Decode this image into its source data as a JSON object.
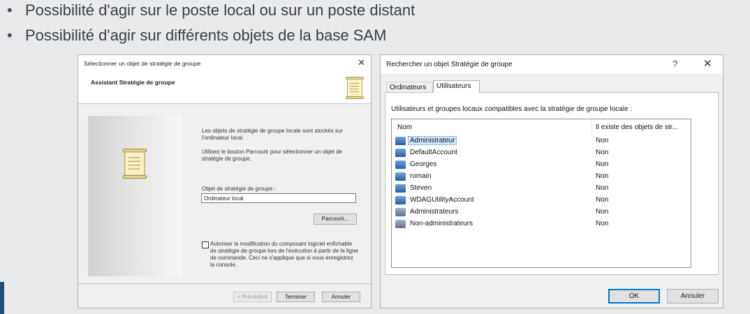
{
  "bullets": [
    "Possibilité d'agir sur le poste local ou sur un poste distant",
    "Possibilité d'agir sur différents objets de la base SAM"
  ],
  "dialog1": {
    "title": "Sélectionner un objet de stratégie de groupe",
    "heading": "Assistant Stratégie de groupe",
    "para1": "Les objets de stratégie de groupe locale sont stockés sur l'ordinateur local.",
    "para2": "Utilisez le bouton Parcourir pour sélectionner un objet de stratégie de groupe.",
    "field_label": "Objet de stratégie de groupe :",
    "field_value": "Ordinateur local",
    "browse": "Parcourir...",
    "checkbox_label": "Autoriser la modification du composant logiciel enfichable de stratégie de groupe lors de l'exécution à partir de la ligne de commande. Ceci ne s'applique que si vous enregistrez la console.",
    "btn_back": "< Précédent",
    "btn_finish": "Terminer",
    "btn_cancel": "Annuler"
  },
  "dialog2": {
    "title": "Rechercher un objet Stratégie de groupe",
    "help": "?",
    "close": "✕",
    "tabs": [
      "Ordinateurs",
      "Utilisateurs"
    ],
    "description": "Utilisateurs et groupes locaux compatibles avec la stratégie de groupe locale :",
    "col_name": "Nom",
    "col_exists": "Il existe des objets de str...",
    "rows": [
      {
        "name": "Administrateur",
        "value": "Non",
        "icon": "user-icon"
      },
      {
        "name": "DefaultAccount",
        "value": "Non",
        "icon": "user-icon"
      },
      {
        "name": "Georges",
        "value": "Non",
        "icon": "user-icon"
      },
      {
        "name": "romain",
        "value": "Non",
        "icon": "user-icon"
      },
      {
        "name": "Steven",
        "value": "Non",
        "icon": "user-icon"
      },
      {
        "name": "WDAGUtilityAccount",
        "value": "Non",
        "icon": "user-icon"
      },
      {
        "name": "Administrateurs",
        "value": "Non",
        "icon": "group-icon"
      },
      {
        "name": "Non-administrateurs",
        "value": "Non",
        "icon": "group-icon"
      }
    ],
    "btn_ok": "OK",
    "btn_cancel": "Annuler"
  },
  "colors": {
    "accent_bar": "#1f4e79",
    "selection": "#cce8ff",
    "focus": "#0078d7"
  }
}
